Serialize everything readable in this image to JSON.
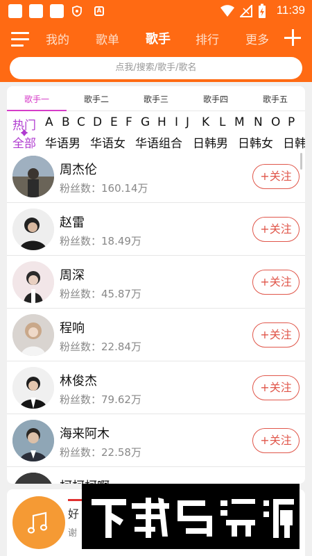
{
  "status_bar": {
    "time": "11:39",
    "badge": "A"
  },
  "nav": {
    "tabs": [
      {
        "label": "我的"
      },
      {
        "label": "歌单"
      },
      {
        "label": "歌手"
      },
      {
        "label": "排行"
      },
      {
        "label": "更多"
      }
    ],
    "active_tab": "歌手"
  },
  "search": {
    "placeholder": "点我/搜索/歌手/歌名"
  },
  "singer_tabs": [
    {
      "label": "歌手一"
    },
    {
      "label": "歌手二"
    },
    {
      "label": "歌手三"
    },
    {
      "label": "歌手四"
    },
    {
      "label": "歌手五"
    }
  ],
  "letter_filter": [
    "热门",
    "A",
    "B",
    "C",
    "D",
    "E",
    "F",
    "G",
    "H",
    "I",
    "J",
    "K",
    "L",
    "M",
    "N",
    "O",
    "P"
  ],
  "category_filter": [
    "全部",
    "华语男",
    "华语女",
    "华语组合",
    "日韩男",
    "日韩女",
    "日韩"
  ],
  "singers": [
    {
      "name": "周杰伦",
      "fans": "粉丝数：160.14万",
      "follow": "+关注"
    },
    {
      "name": "赵雷",
      "fans": "粉丝数：18.49万",
      "follow": "+关注"
    },
    {
      "name": "周深",
      "fans": "粉丝数：45.87万",
      "follow": "+关注"
    },
    {
      "name": "程响",
      "fans": "粉丝数：22.84万",
      "follow": "+关注"
    },
    {
      "name": "林俊杰",
      "fans": "粉丝数：79.62万",
      "follow": "+关注"
    },
    {
      "name": "海来阿木",
      "fans": "粉丝数：22.58万",
      "follow": "+关注"
    },
    {
      "name": "柯柯柯啊",
      "fans": "",
      "follow": ""
    }
  ],
  "player": {
    "title": "好",
    "subtitle": "谢"
  },
  "watermark": {
    "text": "下载鸟资源"
  },
  "colors": {
    "header": "#ff6a13",
    "accent": "#d63cc8",
    "follow": "#e0564a",
    "player_disc": "#f59a34"
  }
}
